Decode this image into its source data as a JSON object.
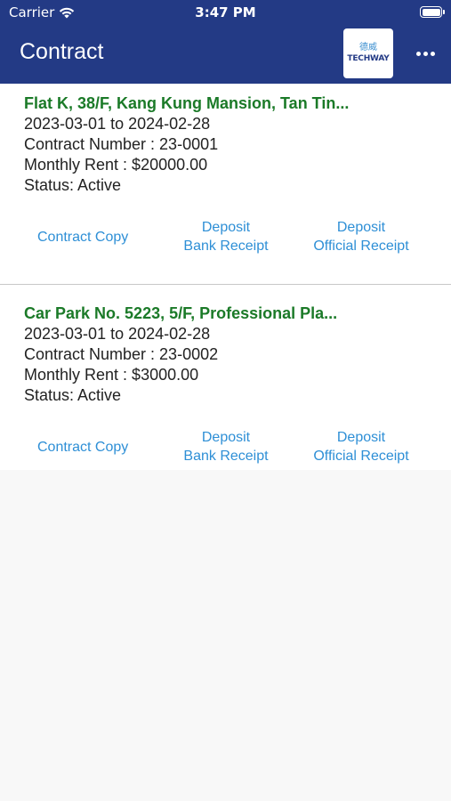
{
  "status_bar": {
    "carrier": "Carrier",
    "time": "3:47 PM"
  },
  "header": {
    "title": "Contract",
    "logo_chinese": "德威",
    "logo_text": "TECHWAY"
  },
  "contracts": [
    {
      "property": "Flat K, 38/F, Kang Kung Mansion, Tan Tin...",
      "period": "2023-03-01 to 2024-02-28",
      "contract_number": "Contract Number : 23-0001",
      "monthly_rent": "Monthly Rent : $20000.00",
      "status": "Status: Active",
      "actions": {
        "contract_copy": "Contract Copy",
        "bank_receipt_line1": "Deposit",
        "bank_receipt_line2": "Bank Receipt",
        "official_receipt_line1": "Deposit",
        "official_receipt_line2": "Official Receipt"
      }
    },
    {
      "property": "Car Park No. 5223, 5/F, Professional Pla...",
      "period": "2023-03-01 to 2024-02-28",
      "contract_number": "Contract Number : 23-0002",
      "monthly_rent": "Monthly Rent : $3000.00",
      "status": "Status: Active",
      "actions": {
        "contract_copy": "Contract Copy",
        "bank_receipt_line1": "Deposit",
        "bank_receipt_line2": "Bank Receipt",
        "official_receipt_line1": "Deposit",
        "official_receipt_line2": "Official Receipt"
      }
    }
  ]
}
